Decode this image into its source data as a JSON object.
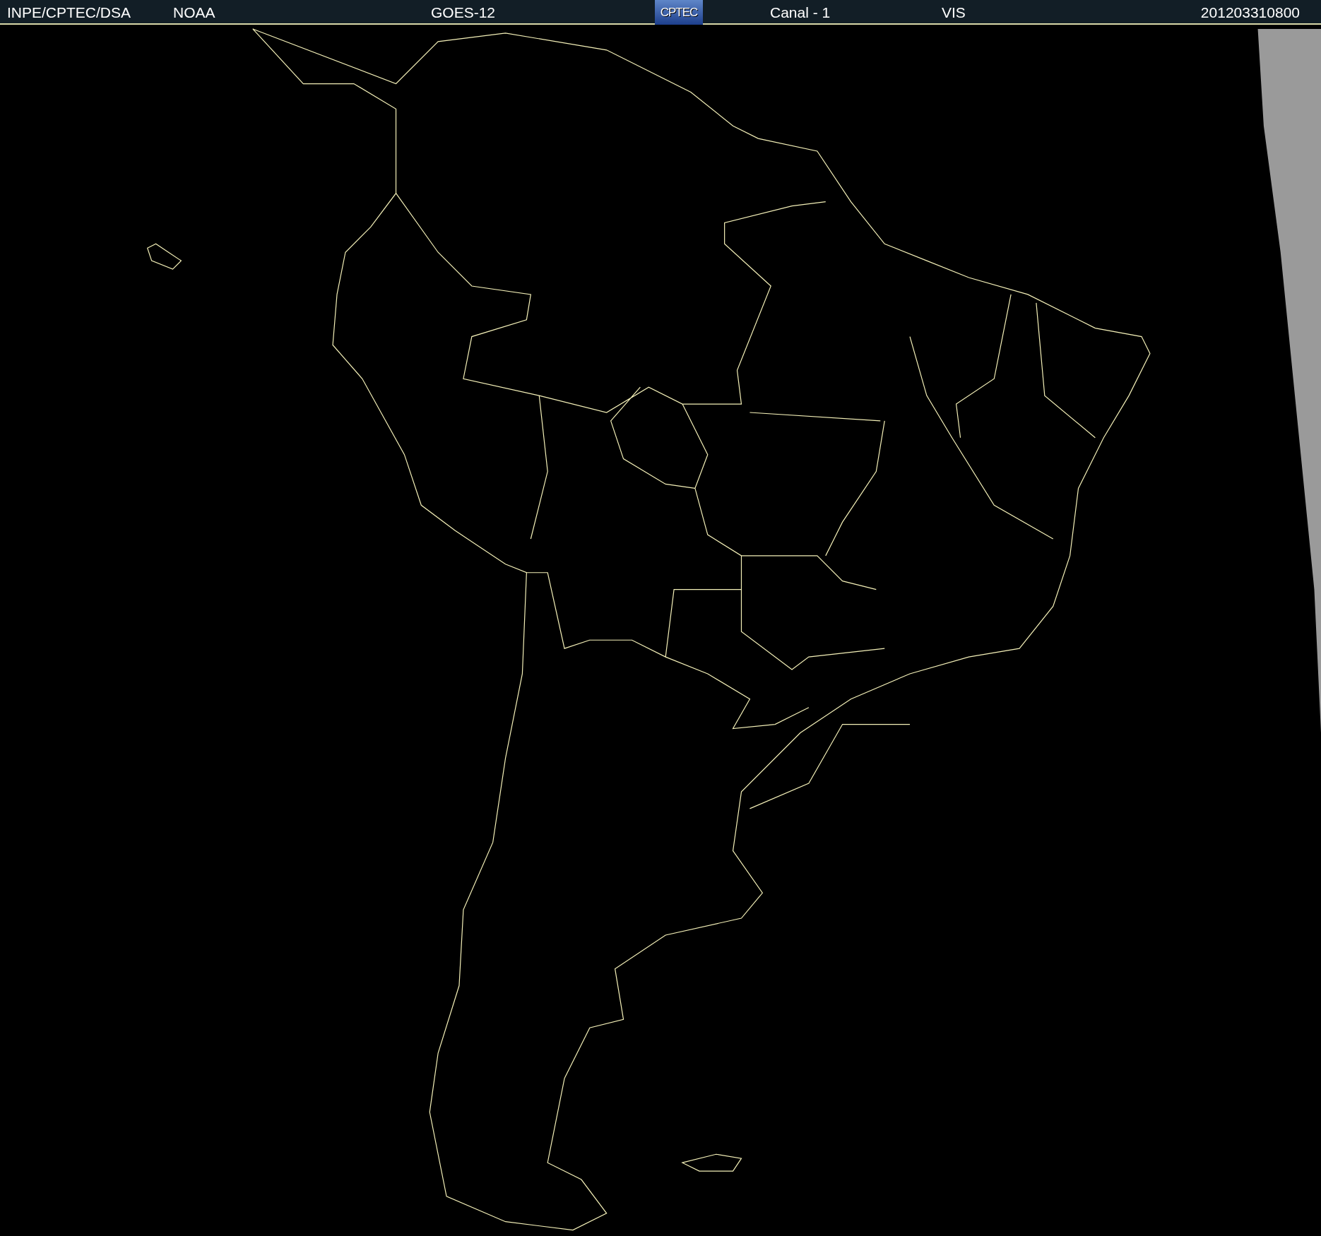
{
  "header": {
    "source": "INPE/CPTEC/DSA",
    "agency": "NOAA",
    "satellite": "GOES-12",
    "logo": "CPTEC",
    "channel": "Canal - 1",
    "band": "VIS",
    "timestamp": "201203310800"
  }
}
